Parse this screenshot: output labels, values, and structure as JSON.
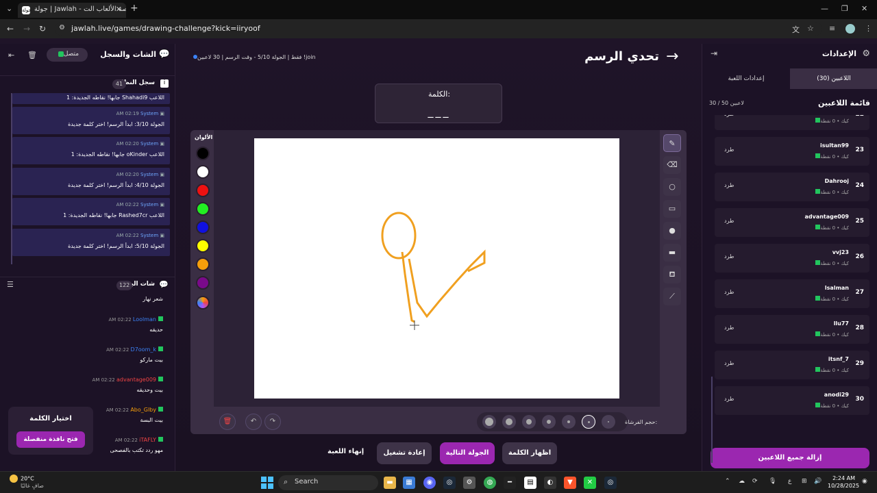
{
  "browser": {
    "tab_title": "جولة | Jawlah - منصة الألعاب الت...",
    "favicon_text": "جولة",
    "url": "jawlah.live/games/drawing-challenge?kick=iiryoof"
  },
  "left_panel": {
    "title": "الشات والسجل",
    "status": "متصل",
    "system_log_title": "سجل النظام",
    "system_log_count": "41",
    "system_messages": [
      {
        "time": "",
        "who": "",
        "text": "اللاعب Shahadi9 جابها! نقاطه الجديدة: 1"
      },
      {
        "time": "AM 02:19",
        "who": "System",
        "text": "الجولة 3/10: ابدأ الرسم! اختر كلمة جديدة"
      },
      {
        "time": "AM 02:20",
        "who": "System",
        "text": "اللاعب oKinder جابها! نقاطه الجديدة: 1"
      },
      {
        "time": "AM 02:20",
        "who": "System",
        "text": "الجولة 4/10: ابدأ الرسم! اختر كلمة جديدة"
      },
      {
        "time": "AM 02:22",
        "who": "System",
        "text": "اللاعب Rashed7cr جابها! نقاطه الجديدة: 1"
      },
      {
        "time": "AM 02:22",
        "who": "System",
        "text": "الجولة 5/10: ابدأ الرسم! اختر كلمة جديدة"
      }
    ],
    "live_chat_title": "شات البث",
    "live_chat_count": "122",
    "chat_messages": [
      {
        "time": "",
        "name": "",
        "color": "#ffffff",
        "text": "شعر نهار"
      },
      {
        "time": "AM 02:22",
        "name": "Loolman",
        "color": "#3b82f6",
        "text": "حديقه"
      },
      {
        "time": "AM 02:22",
        "name": "D7oom_k",
        "color": "#3b82f6",
        "text": "بيت ماركو"
      },
      {
        "time": "AM 02:22",
        "name": "advantage009",
        "color": "#ef4444",
        "text": "بيت وحديقه"
      },
      {
        "time": "AM 02:22",
        "name": "Abo_Glby",
        "color": "#f59e0b",
        "text": "بيت البسة"
      },
      {
        "time": "AM 02:22",
        "name": "iTAFLY",
        "color": "#ef4444",
        "text": "مهو ردد تكتب بالفصحى"
      }
    ],
    "word_choice": {
      "title": "اختيار الكلمة",
      "button": "فتح نافذة منفصلة"
    }
  },
  "center": {
    "title": "تحدي الرسم",
    "round_info": "join! فقط  |  الجولة 5/10 - وقت الرسم  |  30 لاعبين",
    "word_label": "الكلمة:",
    "word_dashes": "___",
    "colors_label": "الألوان",
    "colors": [
      "#000000",
      "#ffffff",
      "#ee1111",
      "#22ee22",
      "#1010e0",
      "#ffff00",
      "#f59e0b",
      "#7a0a8a"
    ],
    "brush_size_label": "حجم الفرشاة:",
    "actions": {
      "show_word": "اظهار الكلمة",
      "next_round": "الجولة التالية",
      "restart": "إعادة تشغيل",
      "end_game": "إنهاء اللعبة"
    }
  },
  "right_panel": {
    "title": "الإعدادات",
    "tab_players": "اللاعبين (30)",
    "tab_game_settings": "إعدادات اللعبة",
    "list_title": "قائمة اللاعبين",
    "list_count": "30 / 50 لاعبين",
    "kick_label": "طرد",
    "players": [
      {
        "rank": "22",
        "name": "",
        "sub": "كيك • 0 نقطة"
      },
      {
        "rank": "23",
        "name": "isultan99",
        "sub": "كيك • 0 نقطة"
      },
      {
        "rank": "24",
        "name": "Dahrooj",
        "sub": "كيك • 0 نقطة"
      },
      {
        "rank": "25",
        "name": "advantage009",
        "sub": "كيك • 0 نقطة"
      },
      {
        "rank": "26",
        "name": "vvj23",
        "sub": "كيك • 0 نقطة"
      },
      {
        "rank": "27",
        "name": "lsalman",
        "sub": "كيك • 0 نقطة"
      },
      {
        "rank": "28",
        "name": "llu77",
        "sub": "كيك • 0 نقطة"
      },
      {
        "rank": "29",
        "name": "itsnf_7",
        "sub": "كيك • 0 نقطة"
      },
      {
        "rank": "30",
        "name": "anodi29",
        "sub": "كيك • 0 نقطة"
      }
    ],
    "remove_all": "إزالة جميع اللاعبين"
  },
  "taskbar": {
    "weather_temp": "20°C",
    "weather_desc": "صافٍ غالبًا",
    "search": "Search",
    "lang": "ع",
    "time": "2:24 AM",
    "date": "10/28/2025"
  }
}
